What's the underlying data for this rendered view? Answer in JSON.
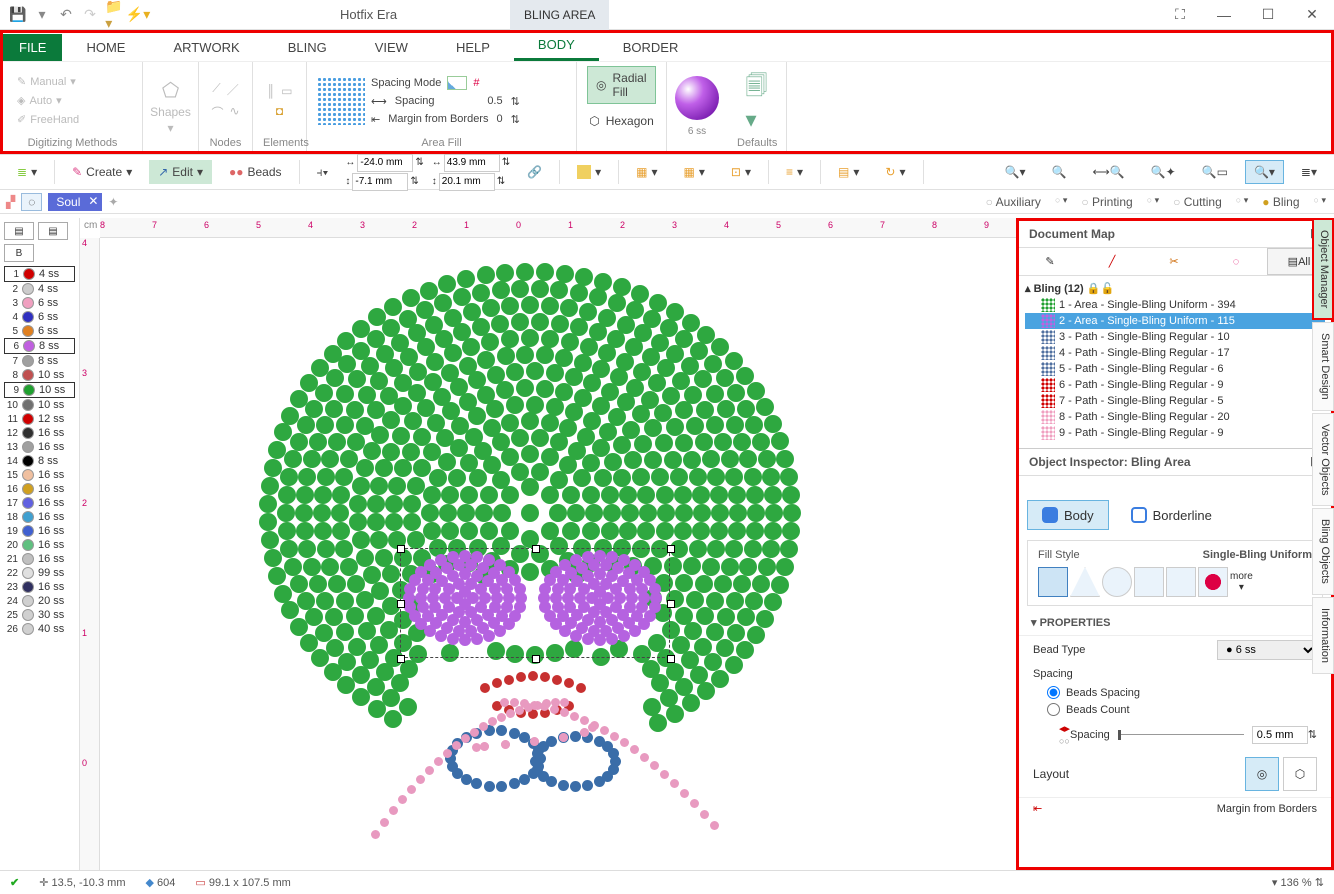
{
  "app_title": "Hotfix Era",
  "context_title": "BLING AREA",
  "ribbon_tabs": [
    "FILE",
    "HOME",
    "ARTWORK",
    "BLING",
    "VIEW",
    "HELP",
    "BODY",
    "BORDER"
  ],
  "active_tab": "BODY",
  "digitizing": {
    "manual": "Manual",
    "auto": "Auto",
    "freehand": "FreeHand",
    "label": "Digitizing Methods"
  },
  "nodes_label": "Nodes",
  "shapes_label": "Shapes",
  "elements_label": "Elements",
  "area_fill": {
    "label": "Area Fill",
    "spacing_mode": "Spacing Mode",
    "spacing": "Spacing",
    "spacing_val": "0.5",
    "margin": "Margin from Borders",
    "margin_val": "0",
    "radial": "Radial Fill",
    "hexagon": "Hexagon"
  },
  "defaults_label": "Defaults",
  "gem_label": "6 ss",
  "toolbar2": {
    "create": "Create",
    "edit": "Edit",
    "beads": "Beads",
    "coord1": "-24.0 mm",
    "coord2": "-7.1 mm",
    "coord3": "43.9 mm",
    "coord4": "20.1 mm"
  },
  "doc_tab": "Soul",
  "right_categories": {
    "auxiliary": "Auxiliary",
    "printing": "Printing",
    "cutting": "Cutting",
    "bling": "Bling"
  },
  "ruler_h": [
    "8",
    "7",
    "6",
    "5",
    "4",
    "3",
    "2",
    "1",
    "0",
    "1",
    "2",
    "3",
    "4",
    "5",
    "6",
    "7",
    "8",
    "9"
  ],
  "ruler_v": [
    "4",
    "3",
    "2",
    "1",
    "0"
  ],
  "left_palette": [
    {
      "n": "1",
      "color": "#d00000",
      "label": "4 ss",
      "boxed": true
    },
    {
      "n": "2",
      "color": "#cccccc",
      "label": "4 ss"
    },
    {
      "n": "3",
      "color": "#f0a0c0",
      "label": "6 ss"
    },
    {
      "n": "4",
      "color": "#3030c0",
      "label": "6 ss"
    },
    {
      "n": "5",
      "color": "#e08020",
      "label": "6 ss"
    },
    {
      "n": "6",
      "color": "#c060e0",
      "label": "8 ss",
      "boxed": true
    },
    {
      "n": "7",
      "color": "#a0a0a0",
      "label": "8 ss"
    },
    {
      "n": "8",
      "color": "#c05050",
      "label": "10 ss"
    },
    {
      "n": "9",
      "color": "#20a030",
      "label": "10 ss",
      "boxed": true
    },
    {
      "n": "10",
      "color": "#707070",
      "label": "10 ss"
    },
    {
      "n": "11",
      "color": "#d00000",
      "label": "12 ss"
    },
    {
      "n": "12",
      "color": "#303030",
      "label": "16 ss"
    },
    {
      "n": "13",
      "color": "#a0a0a0",
      "label": "16 ss"
    },
    {
      "n": "14",
      "color": "#000000",
      "label": "8 ss"
    },
    {
      "n": "15",
      "color": "#f0c0a0",
      "label": "16 ss"
    },
    {
      "n": "16",
      "color": "#d0a020",
      "label": "16 ss"
    },
    {
      "n": "17",
      "color": "#6060e0",
      "label": "16 ss"
    },
    {
      "n": "18",
      "color": "#40a0d0",
      "label": "16 ss"
    },
    {
      "n": "19",
      "color": "#4060d0",
      "label": "16 ss"
    },
    {
      "n": "20",
      "color": "#60c080",
      "label": "16 ss"
    },
    {
      "n": "21",
      "color": "#c0c0c0",
      "label": "16 ss"
    },
    {
      "n": "22",
      "color": "#e0e0e0",
      "label": "99 ss"
    },
    {
      "n": "23",
      "color": "#303060",
      "label": "16 ss"
    },
    {
      "n": "24",
      "color": "#d0d0d0",
      "label": "20 ss"
    },
    {
      "n": "25",
      "color": "#d0d0d0",
      "label": "30 ss"
    },
    {
      "n": "26",
      "color": "#d0d0d0",
      "label": "40 ss"
    }
  ],
  "doc_map": {
    "title": "Document Map",
    "all": "All",
    "root": "Bling (12)",
    "items": [
      {
        "label": "1 - Area - Single-Bling Uniform - 394",
        "color": "#20a030"
      },
      {
        "label": "2 - Area - Single-Bling Uniform - 115",
        "color": "#c060e0",
        "selected": true
      },
      {
        "label": "3 - Path - Single-Bling Regular - 10",
        "color": "#5070a0"
      },
      {
        "label": "4 - Path - Single-Bling Regular - 17",
        "color": "#5070a0"
      },
      {
        "label": "5 - Path - Single-Bling Regular - 6",
        "color": "#5070a0"
      },
      {
        "label": "6 - Path - Single-Bling Regular - 9",
        "color": "#d00000"
      },
      {
        "label": "7 - Path - Single-Bling Regular - 5",
        "color": "#d00000"
      },
      {
        "label": "8 - Path - Single-Bling Regular - 20",
        "color": "#f0a0c0"
      },
      {
        "label": "9 - Path - Single-Bling Regular - 9",
        "color": "#f0a0c0"
      }
    ]
  },
  "inspector": {
    "title": "Object Inspector: Bling Area",
    "body_tab": "Body",
    "border_tab": "Borderline",
    "fill_style_label": "Fill Style",
    "fill_style_value": "Single-Bling Uniform",
    "more": "more",
    "properties": "PROPERTIES",
    "bead_type": "Bead Type",
    "bead_type_val": "6 ss",
    "spacing": "Spacing",
    "beads_spacing": "Beads Spacing",
    "beads_count": "Beads Count",
    "spacing_val": "0.5 mm",
    "layout": "Layout",
    "margin": "Margin from Borders"
  },
  "side_tabs": [
    "Object Manager",
    "Smart Design",
    "Vector Objects",
    "Bling Objects",
    "Information"
  ],
  "status": {
    "coords": "13.5, -10.3 mm",
    "beads": "604",
    "size": "99.1 x 107.5 mm",
    "zoom": "136 %"
  }
}
